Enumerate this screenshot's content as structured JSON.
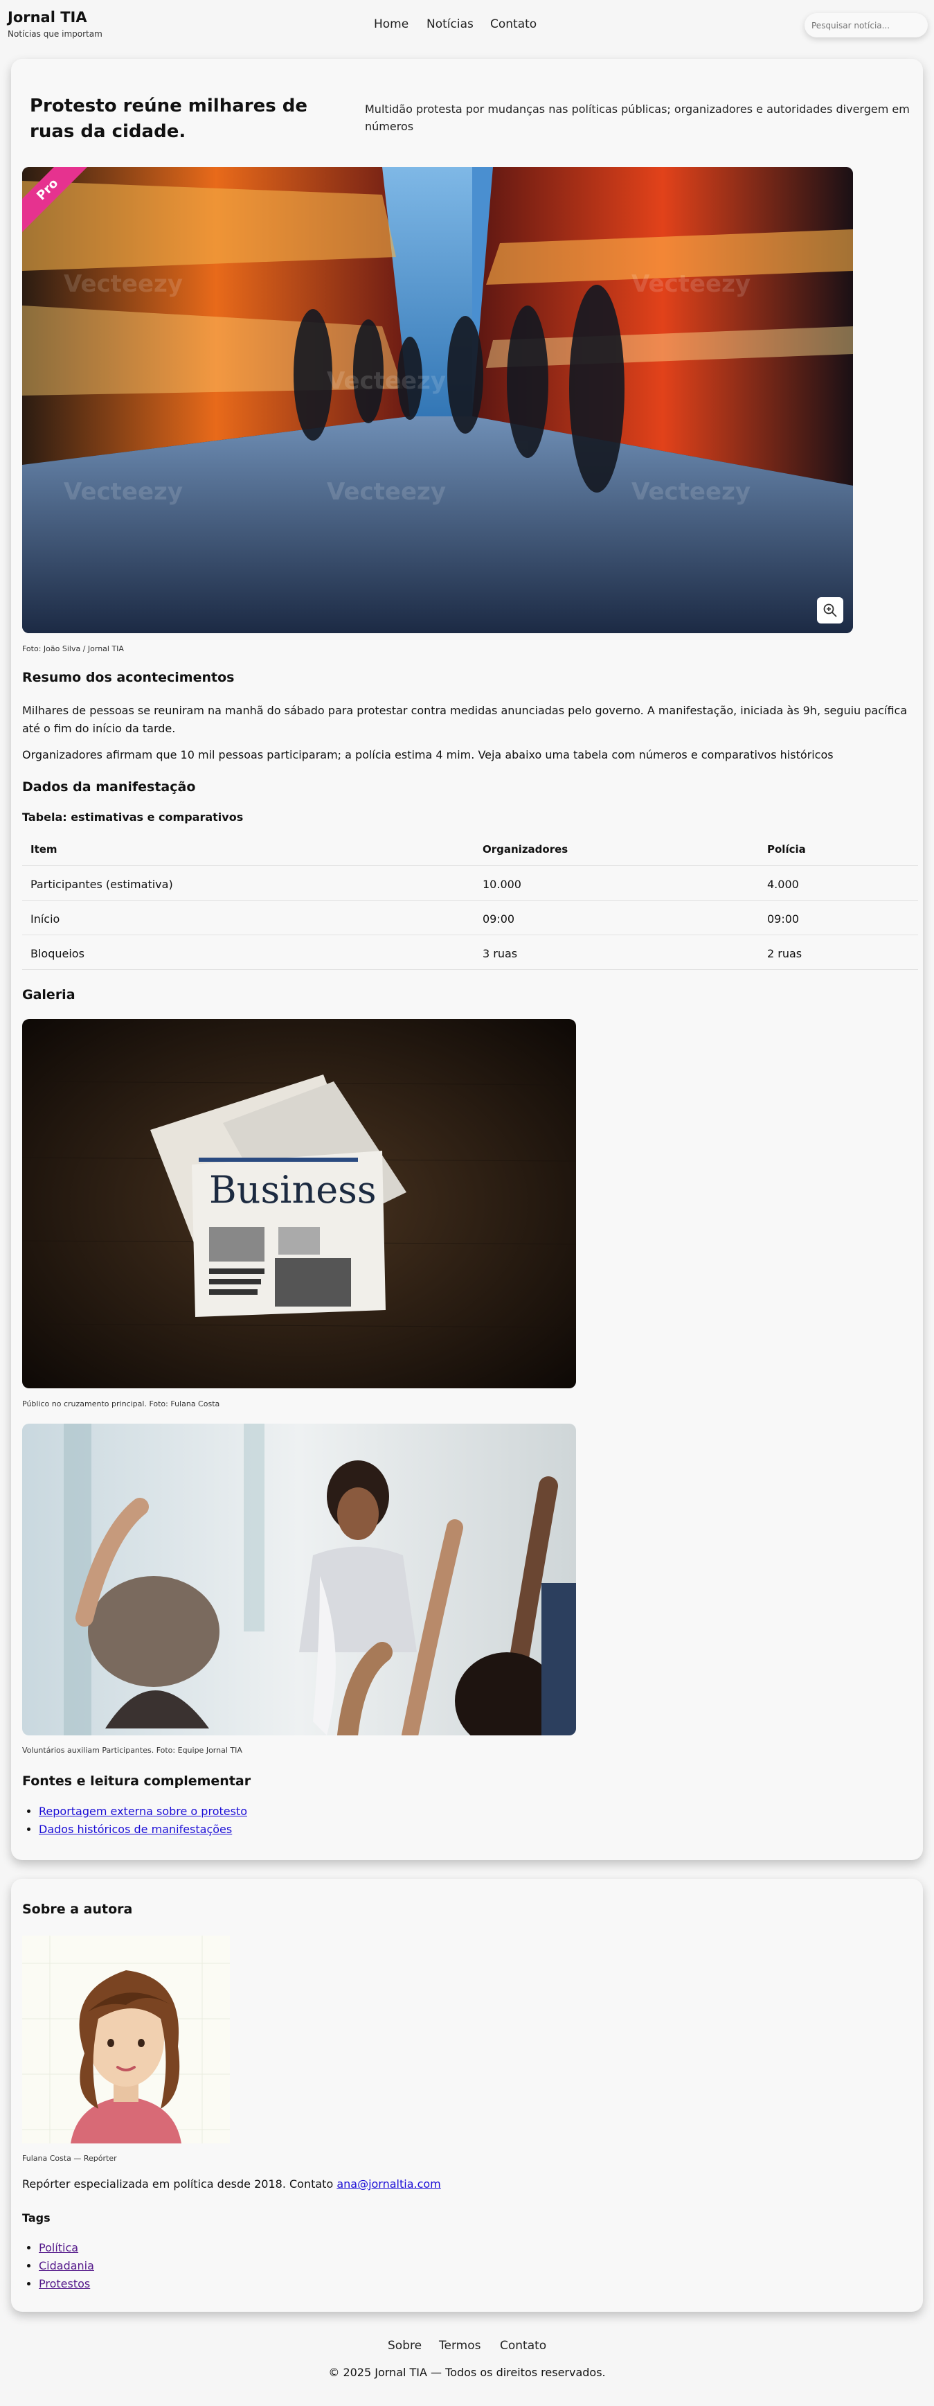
{
  "header": {
    "brand_title": "Jornal TIA",
    "brand_subtitle": "Notícias que importam",
    "nav": [
      "Home",
      "Notícias",
      "Contato"
    ],
    "search_placeholder": "Pesquisar notícia..."
  },
  "article": {
    "headline": "Protesto reúne milhares de ruas da cidade.",
    "dek": "Multidão protesta por mudanças nas políticas públicas; organizadores e autoridades divergem em números",
    "badge": "Pro",
    "hero_icon": "zoom-in-icon",
    "hero_caption": "Foto: João Silva / Jornal TIA",
    "summary_heading": "Resumo dos acontecimentos",
    "summary_p1": "Milhares de pessoas se reuniram na manhã do sábado para protestar contra medidas anunciadas pelo governo. A manifestação, iniciada às 9h, seguiu pacífica até o fim do início da tarde.",
    "summary_p2": "Organizadores afirmam que 10 mil pessoas participaram; a polícia estima 4 mim. Veja abaixo uma tabela com números e comparativos históricos",
    "data_heading": "Dados da manifestação",
    "table_caption": "Tabela: estimativas e comparativos",
    "table": {
      "headers": [
        "Item",
        "Organizadores",
        "Polícia"
      ],
      "rows": [
        [
          "Participantes (estimativa)",
          "10.000",
          "4.000"
        ],
        [
          "Início",
          "09:00",
          "09:00"
        ],
        [
          "Bloqueios",
          "3 ruas",
          "2 ruas"
        ]
      ]
    },
    "gallery_heading": "Galeria",
    "gallery": [
      {
        "caption": "Público no cruzamento principal. Foto: Fulana Costa",
        "headline_text": "Business"
      },
      {
        "caption": "Voluntários auxiliam Participantes. Foto: Equipe Jornal TIA"
      }
    ],
    "sources_heading": "Fontes e leitura complementar",
    "sources": [
      "Reportagem externa sobre o protesto",
      "Dados históricos de manifestações"
    ]
  },
  "author": {
    "heading": "Sobre a autora",
    "caption": "Fulana Costa — Repórter",
    "bio": "Repórter especializada em política desde 2018. Contato ",
    "email": "ana@jornaltia.com",
    "tags_heading": "Tags",
    "tags": [
      "Política",
      "Cidadania",
      "Protestos"
    ]
  },
  "footer": {
    "nav": [
      "Sobre",
      "Termos",
      "Contato"
    ],
    "copyright": "© 2025 Jornal TIA — Todos os direitos reservados."
  },
  "colors": {
    "background": "#f6f6f6",
    "badge": "#e6328f",
    "link": "#1a0dd6",
    "visited_link": "#551a8b"
  }
}
